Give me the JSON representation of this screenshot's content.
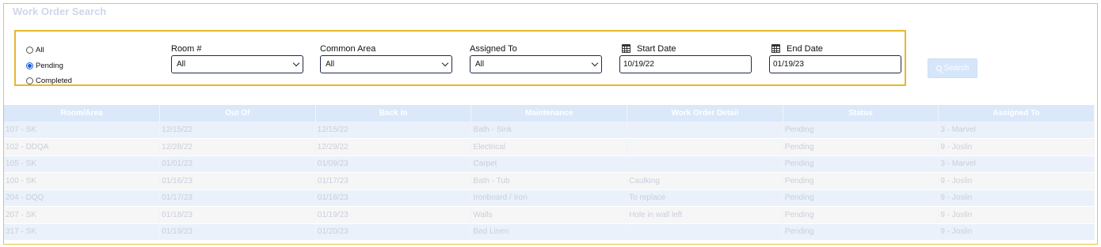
{
  "page_title": "Work Order Search",
  "status_filter": {
    "options": [
      {
        "label": "All",
        "checked": false
      },
      {
        "label": "Pending",
        "checked": true
      },
      {
        "label": "Completed",
        "checked": false
      }
    ]
  },
  "filters": {
    "room": {
      "label": "Room #",
      "value": "All"
    },
    "common_area": {
      "label": "Common Area",
      "value": "All"
    },
    "assigned_to": {
      "label": "Assigned To",
      "value": "All"
    },
    "start_date": {
      "label": "Start Date",
      "value": "10/19/22"
    },
    "end_date": {
      "label": "End Date",
      "value": "01/19/23"
    }
  },
  "search_button": {
    "label": "Search"
  },
  "table": {
    "columns": [
      "Room/Area",
      "Out Of",
      "Back In",
      "Maintenance",
      "Work Order Detail",
      "Status",
      "Assigned To"
    ],
    "rows": [
      [
        "107 - SK",
        "12/15/22",
        "12/15/22",
        "Bath - Sink",
        "",
        "Pending",
        "3 - Marvel"
      ],
      [
        "102 - DDQA",
        "12/28/22",
        "12/29/22",
        "Electrical",
        "",
        "Pending",
        "9 - Joslin"
      ],
      [
        "105 - SK",
        "01/01/23",
        "01/09/23",
        "Carpet",
        "",
        "Pending",
        "3 - Marvel"
      ],
      [
        "100 - SK",
        "01/16/23",
        "01/17/23",
        "Bath - Tub",
        "Caulking",
        "Pending",
        "9 - Joslin"
      ],
      [
        "204 - DQQ",
        "01/17/23",
        "01/18/23",
        "Ironboard / Iron",
        "To replace",
        "Pending",
        "9 - Joslin"
      ],
      [
        "207 - SK",
        "01/18/23",
        "01/19/23",
        "Walls",
        "Hole in wall left",
        "Pending",
        "9 - Joslin"
      ],
      [
        "317 - SK",
        "01/19/23",
        "01/20/23",
        "Bed Linen",
        "",
        "Pending",
        "9 - Joslin"
      ]
    ]
  }
}
